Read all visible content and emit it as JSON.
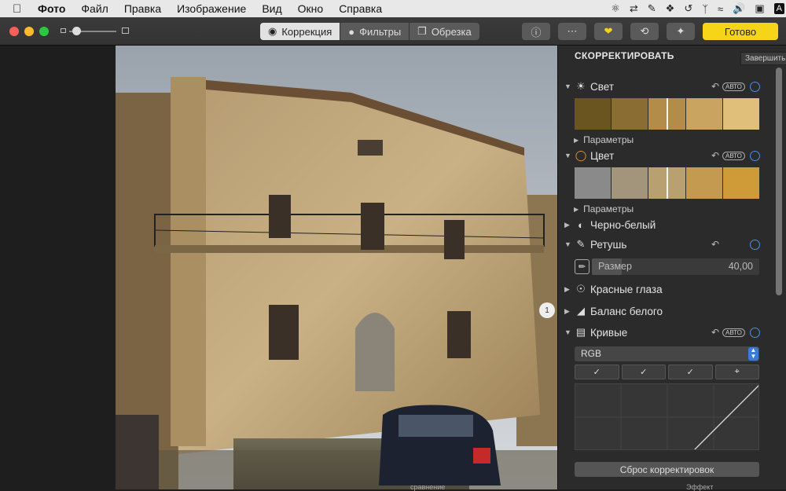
{
  "menubar": {
    "app_name": "Фото",
    "items": [
      "Файл",
      "Правка",
      "Изображение",
      "Вид",
      "Окно",
      "Справка"
    ],
    "tray_badge": "A"
  },
  "toolbar": {
    "tabs": [
      {
        "label": "Коррекция",
        "icon": "dial-icon",
        "active": true
      },
      {
        "label": "Фильтры",
        "icon": "filters-icon",
        "active": false
      },
      {
        "label": "Обрезка",
        "icon": "crop-icon",
        "active": false
      }
    ],
    "buttons": [
      "info-icon",
      "more-icon",
      "heart-icon",
      "rotate-icon",
      "magic-wand-icon"
    ],
    "done_label": "Готово",
    "accent": "#f6d518"
  },
  "panel": {
    "title": "СКОРРЕКТИРОВАТЬ",
    "tooltip": "Завершить",
    "auto_label": "АВТО",
    "sections": {
      "light": {
        "label": "Свет",
        "params": "Параметры"
      },
      "color": {
        "label": "Цвет",
        "params": "Параметры"
      },
      "bw": {
        "label": "Черно-белый"
      },
      "retouch": {
        "label": "Ретушь",
        "size_label": "Размер",
        "size_value": "40,00",
        "size_fraction": 0.18
      },
      "redeye": {
        "label": "Красные глаза"
      },
      "whitebalance": {
        "label": "Баланс белого"
      },
      "curves": {
        "label": "Кривые",
        "channel": "RGB"
      }
    },
    "reset_label": "Сброс корректировок"
  },
  "scrubber": {
    "label": "1"
  },
  "dock": {
    "left_label": "сравнение",
    "right_label": "Эффект"
  }
}
